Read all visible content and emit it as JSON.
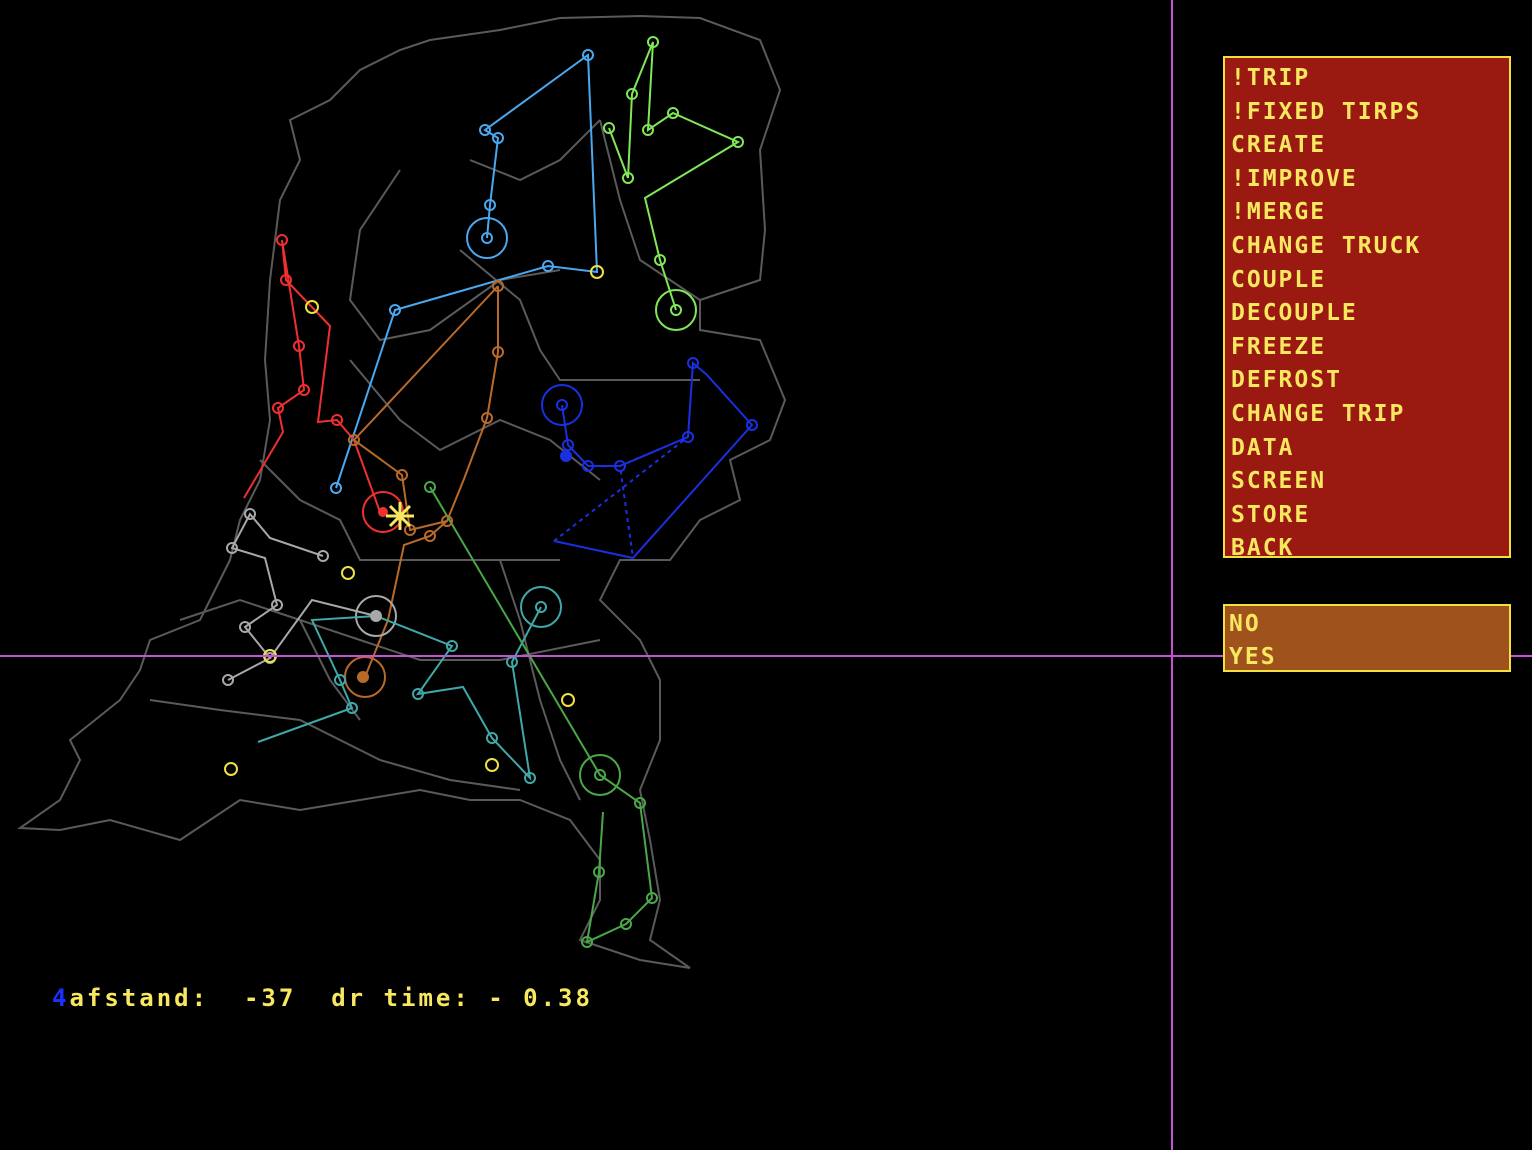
{
  "menu": {
    "items": [
      {
        "label": "!TRIP",
        "key": "trip"
      },
      {
        "label": "!FIXED TIRPS",
        "key": "fixed-tirps"
      },
      {
        "label": "CREATE",
        "key": "create"
      },
      {
        "label": "!IMPROVE",
        "key": "improve"
      },
      {
        "label": "!MERGE",
        "key": "merge"
      },
      {
        "label": "CHANGE TRUCK",
        "key": "change-truck"
      },
      {
        "label": "COUPLE",
        "key": "couple"
      },
      {
        "label": "DECOUPLE",
        "key": "decouple"
      },
      {
        "label": "FREEZE",
        "key": "freeze"
      },
      {
        "label": "DEFROST",
        "key": "defrost"
      },
      {
        "label": "CHANGE TRIP",
        "key": "change-trip"
      },
      {
        "label": "DATA",
        "key": "data"
      },
      {
        "label": "SCREEN",
        "key": "screen"
      },
      {
        "label": "STORE",
        "key": "store"
      },
      {
        "label": "BACK",
        "key": "back"
      }
    ]
  },
  "confirm": {
    "no_label": "NO",
    "yes_label": "YES"
  },
  "status": {
    "trip_number": "4",
    "text": "afstand:  -37  dr time: - 0.38"
  },
  "colors": {
    "menu_bg": "#9a1a12",
    "confirm_bg": "#a0521c",
    "menu_text": "#f8e860",
    "crosshair": "#c850d8",
    "map_border": "#5a5a5a"
  }
}
